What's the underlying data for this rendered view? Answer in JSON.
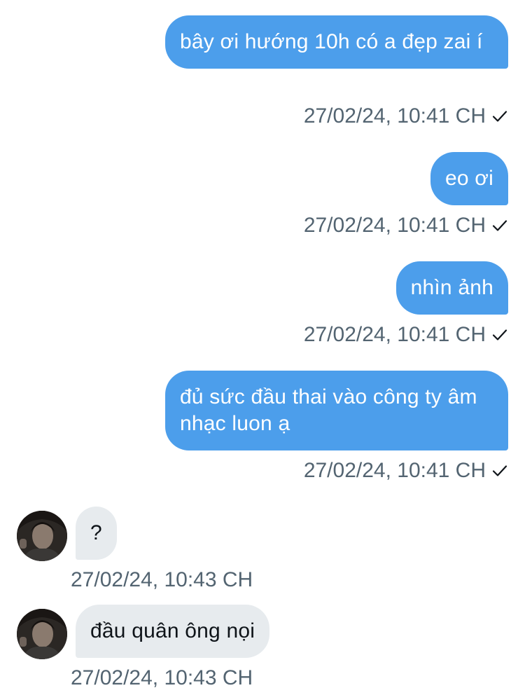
{
  "conversation": {
    "messages": [
      {
        "direction": "out",
        "text": "bây ơi hướng 10h có a đẹp zai í",
        "timestamp": "27/02/24, 10:41 CH",
        "status": "sent"
      },
      {
        "direction": "out",
        "text": "eo ơi",
        "timestamp": "27/02/24, 10:41 CH",
        "status": "sent"
      },
      {
        "direction": "out",
        "text": "nhìn ảnh",
        "timestamp": "27/02/24, 10:41 CH",
        "status": "sent"
      },
      {
        "direction": "out",
        "text": "đủ sức đầu thai vào công ty âm nhạc luon ạ",
        "timestamp": "27/02/24, 10:41 CH",
        "status": "sent"
      },
      {
        "direction": "in",
        "text": "?",
        "timestamp": "27/02/24, 10:43 CH"
      },
      {
        "direction": "in",
        "text": "đầu quân ông nọi",
        "timestamp": "27/02/24, 10:43 CH"
      }
    ]
  },
  "colors": {
    "outgoing_bubble": "#4c9eeb",
    "incoming_bubble": "#e7ebee",
    "timestamp_text": "#536471"
  },
  "icons": {
    "read_receipt": "check-icon",
    "avatar": "avatar"
  }
}
